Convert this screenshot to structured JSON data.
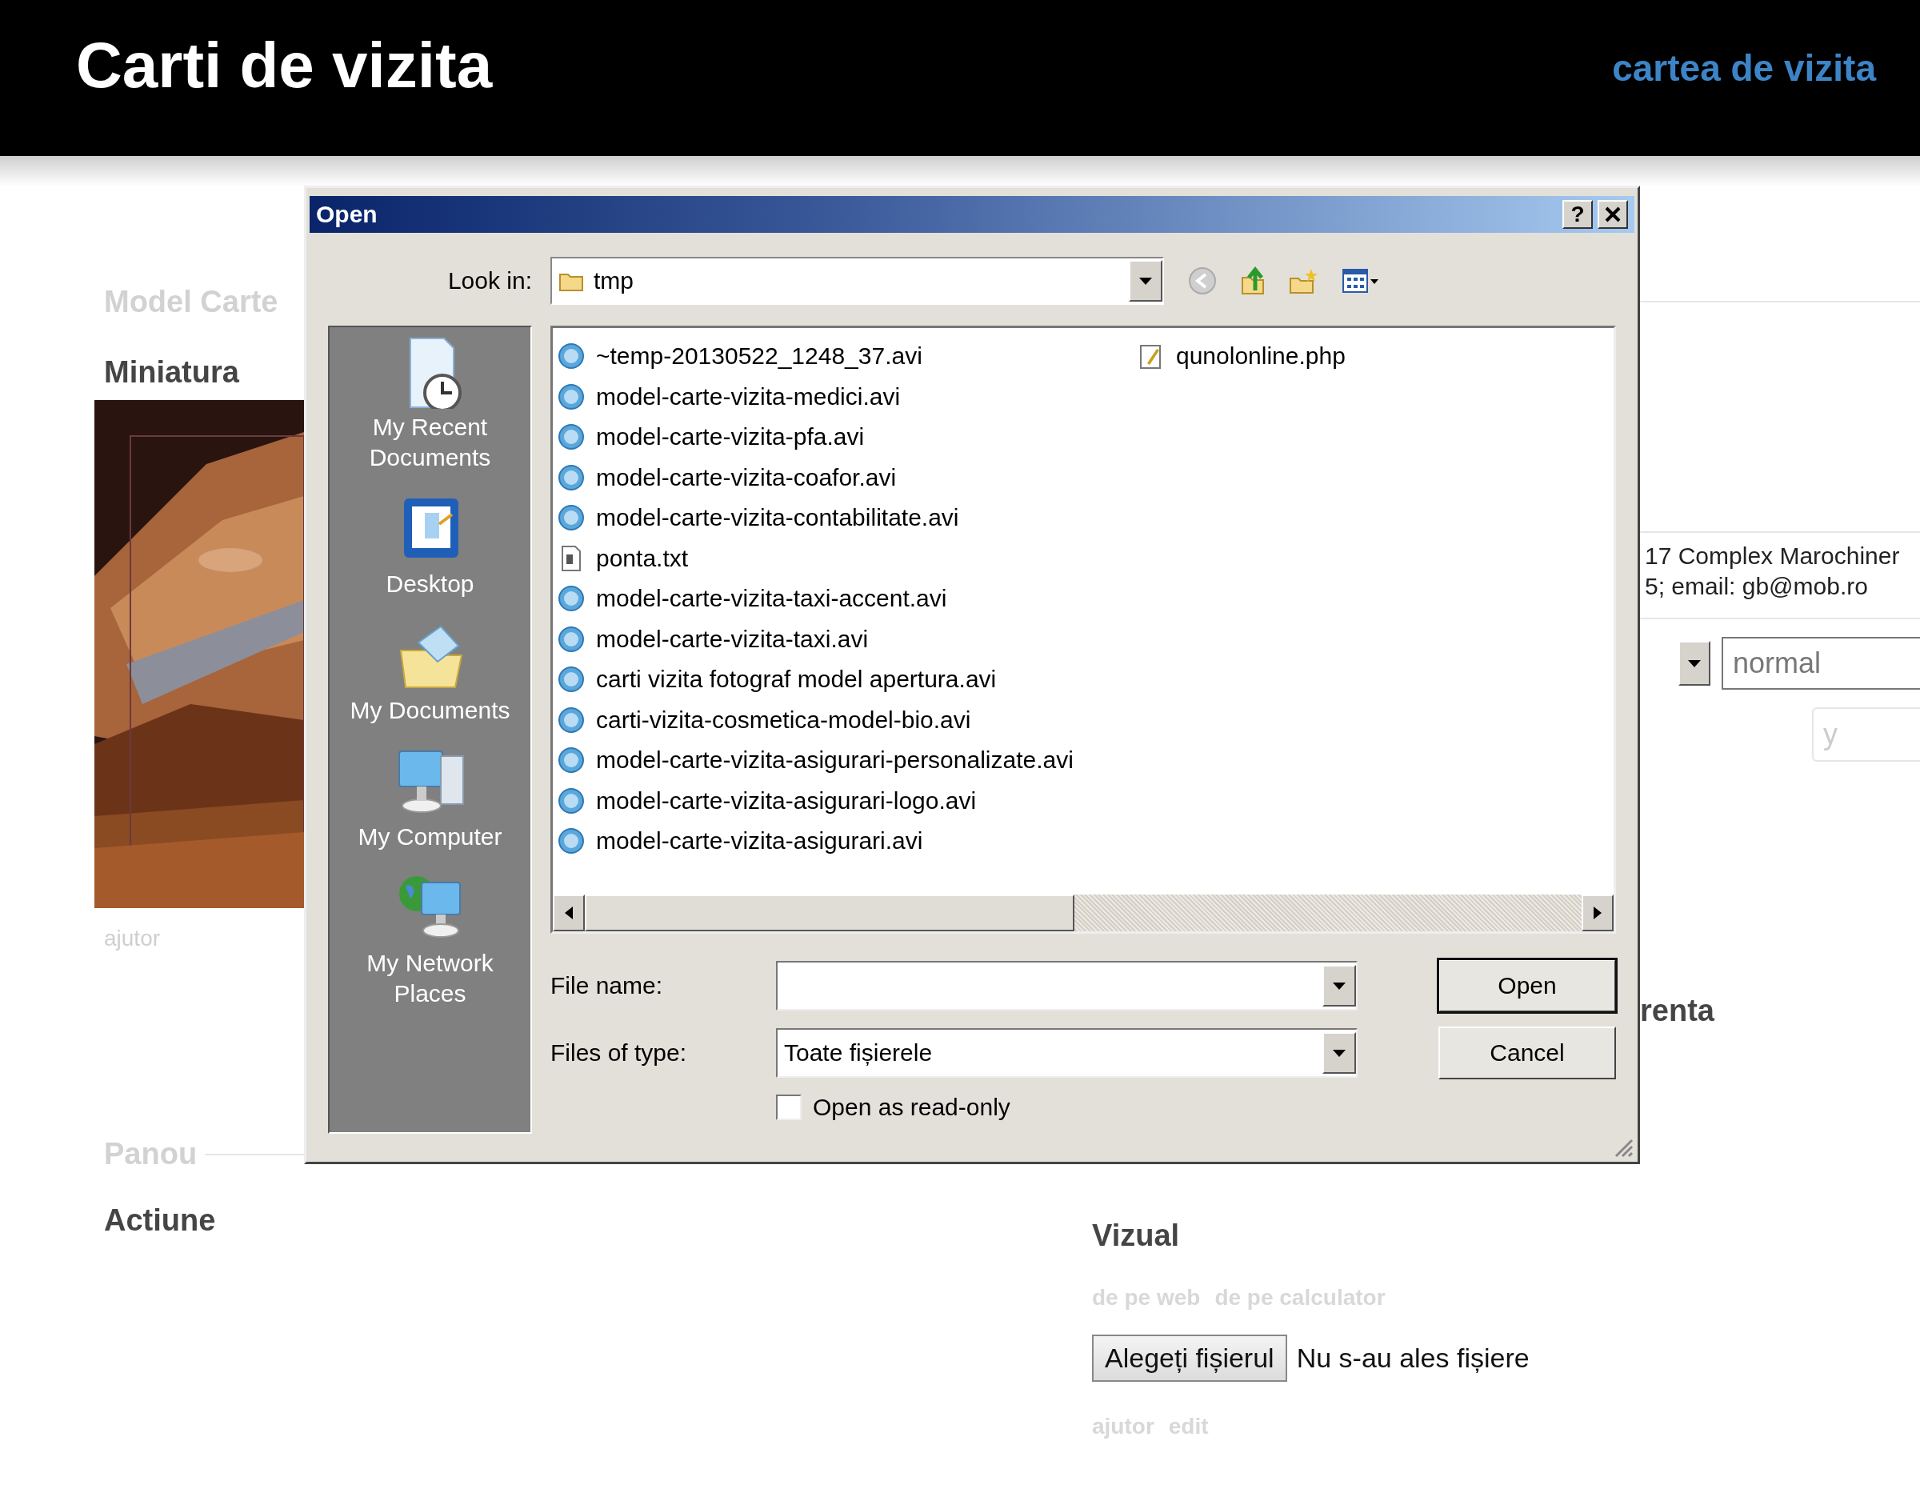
{
  "header": {
    "title": "Carti de vizita",
    "link": "cartea de vizita"
  },
  "page": {
    "left": {
      "section_title": "Model Carte",
      "heading": "Miniatura",
      "help_link": "ajutor",
      "panel_title": "Panou",
      "panel_heading": "Actiune"
    },
    "right": {
      "address_lines": [
        "17 Complex Marochiner",
        "5; email: gb@mob.ro"
      ],
      "style_value": "normal",
      "y_placeholder": "y",
      "section_fragment": "renta",
      "visual_heading": "Vizual",
      "source_links": [
        "de pe web",
        "de pe calculator"
      ],
      "file_button": "Alegeți fișierul",
      "file_status": "Nu s-au ales fișiere",
      "links": [
        "ajutor",
        "edit"
      ]
    }
  },
  "dialog": {
    "title": "Open",
    "help_button": "?",
    "look_in": {
      "label": "Look in:",
      "value": "tmp"
    },
    "places": [
      {
        "label": "My Recent Documents",
        "kind": "recent"
      },
      {
        "label": "Desktop",
        "kind": "desktop"
      },
      {
        "label": "My Documents",
        "kind": "documents"
      },
      {
        "label": "My Computer",
        "kind": "computer"
      },
      {
        "label": "My Network Places",
        "kind": "network"
      }
    ],
    "files": [
      {
        "name": "~temp-20130522_1248_37.avi",
        "kind": "video"
      },
      {
        "name": "model-carte-vizita-medici.avi",
        "kind": "video"
      },
      {
        "name": "model-carte-vizita-pfa.avi",
        "kind": "video"
      },
      {
        "name": "model-carte-vizita-coafor.avi",
        "kind": "video"
      },
      {
        "name": "model-carte-vizita-contabilitate.avi",
        "kind": "video"
      },
      {
        "name": "ponta.txt",
        "kind": "text"
      },
      {
        "name": "model-carte-vizita-taxi-accent.avi",
        "kind": "video"
      },
      {
        "name": "model-carte-vizita-taxi.avi",
        "kind": "video"
      },
      {
        "name": "carti vizita fotograf model apertura.avi",
        "kind": "video"
      },
      {
        "name": "carti-vizita-cosmetica-model-bio.avi",
        "kind": "video"
      },
      {
        "name": "model-carte-vizita-asigurari-personalizate.avi",
        "kind": "video"
      },
      {
        "name": "model-carte-vizita-asigurari-logo.avi",
        "kind": "video"
      },
      {
        "name": "model-carte-vizita-asigurari.avi",
        "kind": "video"
      },
      {
        "name": "qunolonline.php",
        "kind": "script"
      }
    ],
    "file_name": {
      "label": "File name:"
    },
    "file_type": {
      "label": "Files of type:",
      "value": "Toate fișierele"
    },
    "read_only": {
      "label": "Open as read-only",
      "checked": false
    },
    "buttons": [
      {
        "label": "Open",
        "default": true
      },
      {
        "label": "Cancel",
        "default": false
      }
    ]
  }
}
